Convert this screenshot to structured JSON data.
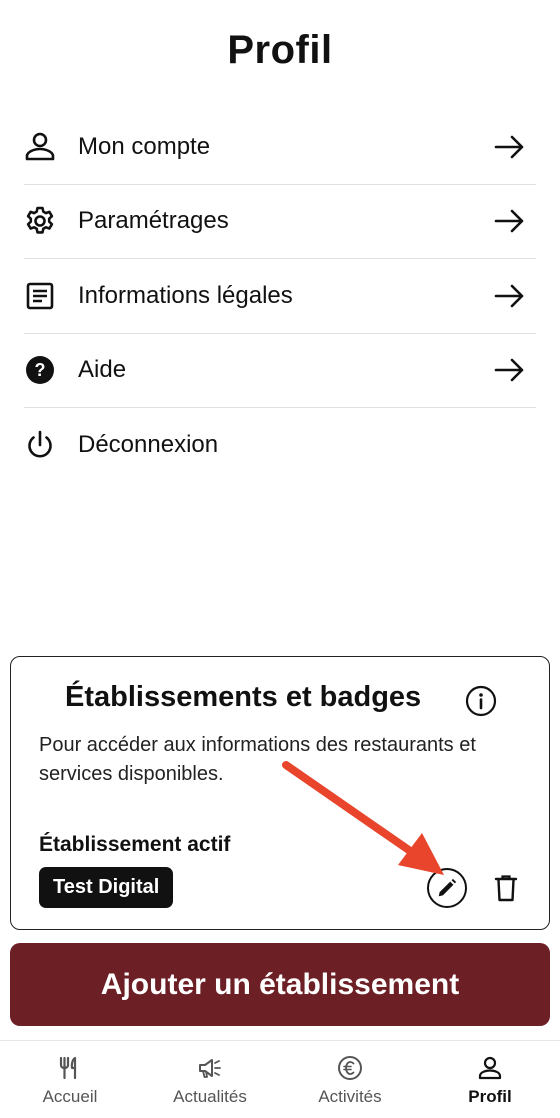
{
  "header": {
    "title": "Profil"
  },
  "menu": {
    "items": [
      {
        "label": "Mon compte",
        "icon": "person-icon",
        "has_arrow": true
      },
      {
        "label": "Paramétrages",
        "icon": "gear-icon",
        "has_arrow": true
      },
      {
        "label": "Informations légales",
        "icon": "document-icon",
        "has_arrow": true
      },
      {
        "label": "Aide",
        "icon": "help-icon",
        "has_arrow": true
      },
      {
        "label": "Déconnexion",
        "icon": "power-icon",
        "has_arrow": false
      }
    ]
  },
  "establishments": {
    "title": "Établissements et badges",
    "description": "Pour accéder aux informations des restaurants et services disponibles.",
    "active_label": "Établissement actif",
    "active_name": "Test Digital"
  },
  "add_button": {
    "label": "Ajouter un établissement"
  },
  "bottom_nav": {
    "items": [
      {
        "label": "Accueil",
        "icon": "fork-knife-icon",
        "active": false
      },
      {
        "label": "Actualités",
        "icon": "megaphone-icon",
        "active": false
      },
      {
        "label": "Activités",
        "icon": "euro-icon",
        "active": false
      },
      {
        "label": "Profil",
        "icon": "person-icon",
        "active": true
      }
    ]
  },
  "colors": {
    "accent": "#6c1f24",
    "annotation_arrow": "#e8452c",
    "text": "#111111"
  }
}
